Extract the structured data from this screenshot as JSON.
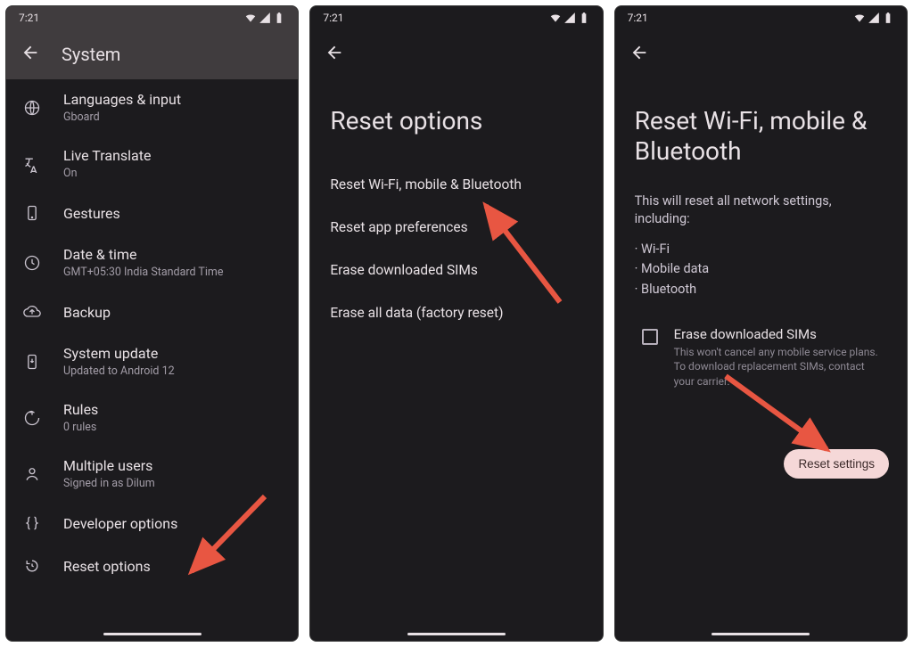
{
  "status": {
    "time": "7:21"
  },
  "screen1": {
    "title": "System",
    "items": [
      {
        "label": "Languages & input",
        "sub": "Gboard"
      },
      {
        "label": "Live Translate",
        "sub": "On"
      },
      {
        "label": "Gestures",
        "sub": ""
      },
      {
        "label": "Date & time",
        "sub": "GMT+05:30 India Standard Time"
      },
      {
        "label": "Backup",
        "sub": ""
      },
      {
        "label": "System update",
        "sub": "Updated to Android 12"
      },
      {
        "label": "Rules",
        "sub": "0 rules"
      },
      {
        "label": "Multiple users",
        "sub": "Signed in as Dilum"
      },
      {
        "label": "Developer options",
        "sub": ""
      },
      {
        "label": "Reset options",
        "sub": ""
      }
    ]
  },
  "screen2": {
    "title": "Reset options",
    "items": [
      "Reset Wi-Fi, mobile & Bluetooth",
      "Reset app preferences",
      "Erase downloaded SIMs",
      "Erase all data (factory reset)"
    ]
  },
  "screen3": {
    "title": "Reset Wi-Fi, mobile & Bluetooth",
    "desc": "This will reset all network settings, including:",
    "bullets": [
      "Wi-Fi",
      "Mobile data",
      "Bluetooth"
    ],
    "checkbox": {
      "title": "Erase downloaded SIMs",
      "sub": "This won't cancel any mobile service plans. To download replacement SIMs, contact your carrier."
    },
    "button": "Reset settings"
  }
}
